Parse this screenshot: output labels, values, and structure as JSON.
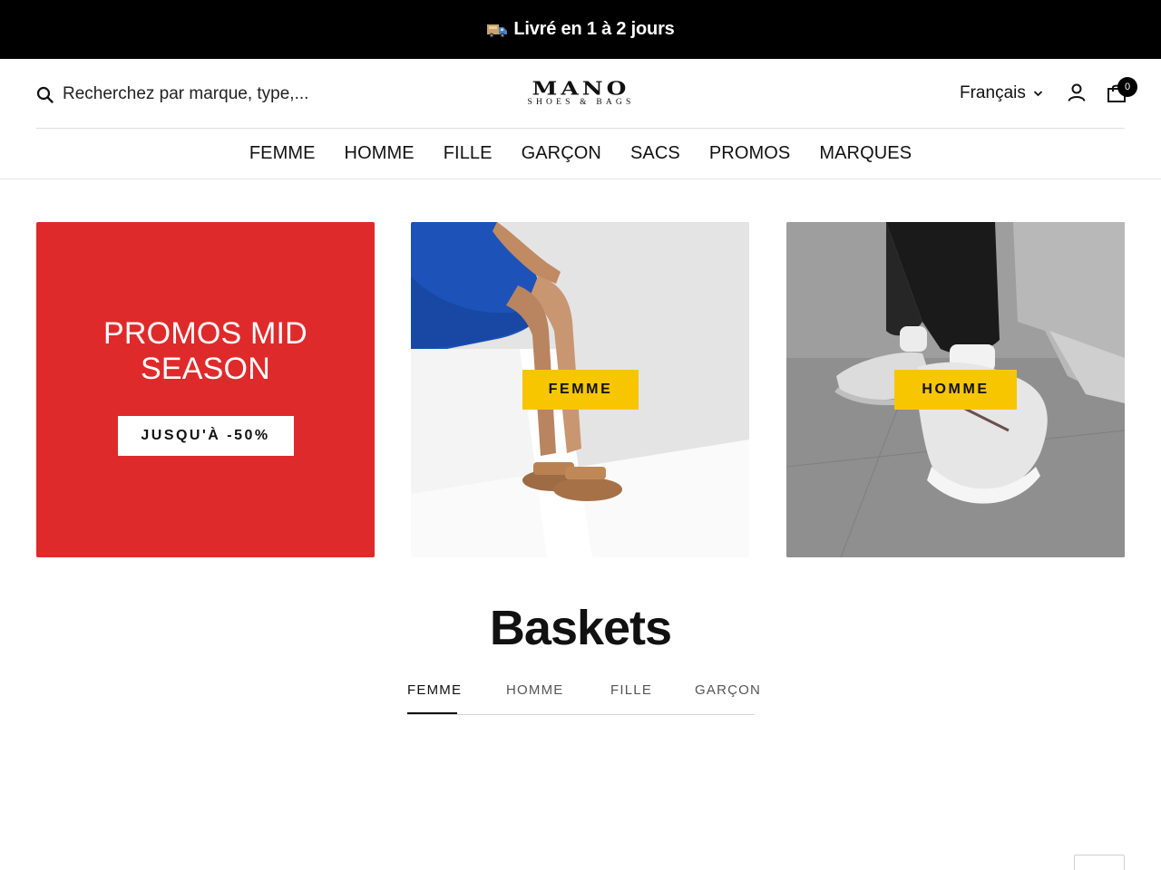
{
  "announcement": {
    "text": "Livré en 1 à 2 jours",
    "icon": "truck-icon"
  },
  "header": {
    "search": {
      "placeholder": "Recherchez par marque, type,..."
    },
    "logo": {
      "main": "MANO",
      "sub": "SHOES & BAGS"
    },
    "language": "Français",
    "cart_count": "0"
  },
  "nav": {
    "items": [
      "FEMME",
      "HOMME",
      "FILLE",
      "GARÇON",
      "SACS",
      "PROMOS",
      "MARQUES"
    ]
  },
  "tiles": {
    "promo": {
      "title": "PROMOS MID SEASON",
      "button": "JUSQU'À -50%"
    },
    "femme": {
      "label": "FEMME"
    },
    "homme": {
      "label": "HOMME"
    }
  },
  "section": {
    "title": "Baskets",
    "tabs": [
      "FEMME",
      "HOMME",
      "FILLE",
      "GARÇON"
    ],
    "active_tab": "FEMME"
  },
  "colors": {
    "announcement_bg": "#000000",
    "promo_red": "#df2a2b",
    "label_yellow": "#f7c600"
  }
}
